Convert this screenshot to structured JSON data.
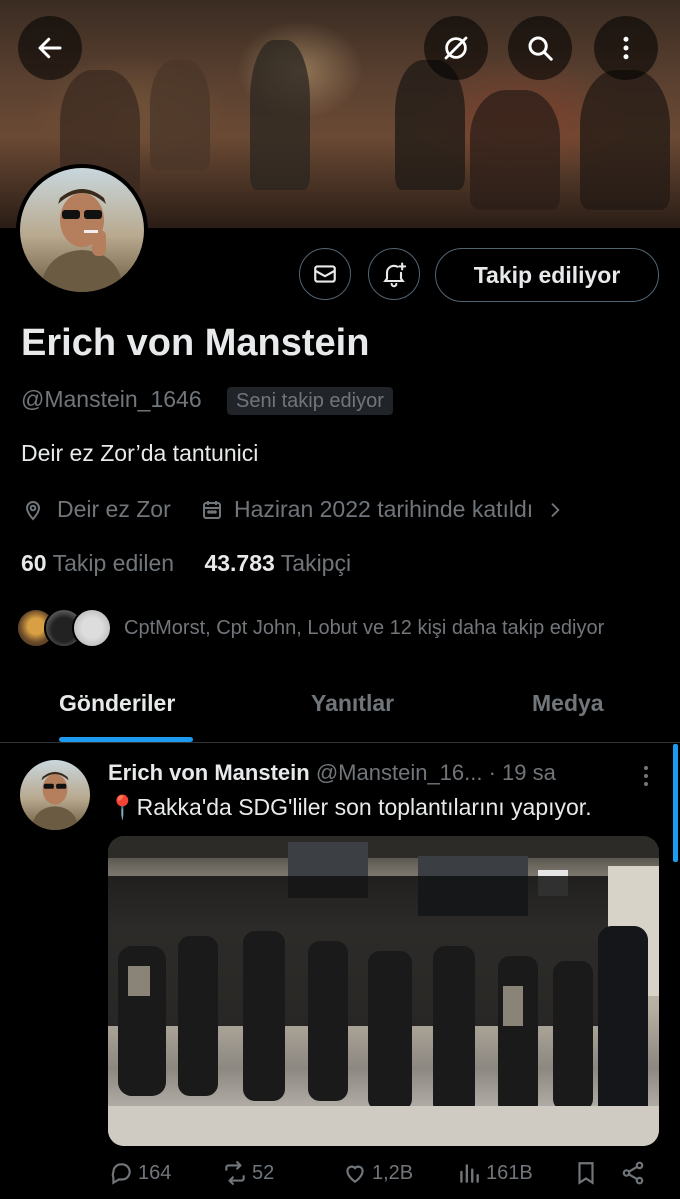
{
  "profile": {
    "name": "Erich von Manstein",
    "handle": "@Manstein_1646",
    "follows_you_badge": "Seni takip ediyor",
    "bio": "Deir ez Zor’da tantunici",
    "location": "Deir ez Zor",
    "joined": "Haziran 2022 tarihinde katıldı",
    "following_count": "60",
    "following_label": "Takip edilen",
    "followers_count": "43.783",
    "followers_label": "Takipçi",
    "followed_by_text": "CptMorst, Cpt John, Lobut ve 12 kişi daha takip ediyor"
  },
  "actions": {
    "follow_button": "Takip ediliyor"
  },
  "tabs": [
    "Gönderiler",
    "Yanıtlar",
    "Medya"
  ],
  "post": {
    "author": "Erich von Manstein",
    "handle_time": "@Manstein_16... · 19 sa",
    "emoji": "📍",
    "text": "Rakka'da SDG'liler son toplantılarını yapıyor.",
    "replies": "164",
    "reposts": "52",
    "likes": "1,2B",
    "views": "161B"
  },
  "icons": {
    "back": "arrow-left-icon",
    "grok": "grok-icon",
    "search": "search-icon",
    "more": "more-vertical-icon",
    "message": "envelope-icon",
    "notify": "bell-plus-icon",
    "location": "location-pin-icon",
    "calendar": "calendar-icon",
    "chevron": "chevron-right-icon"
  },
  "colors": {
    "accent": "#1d9bf0",
    "secondary_text": "#71767b",
    "primary_text": "#e7e9ea",
    "border": "#536471"
  }
}
